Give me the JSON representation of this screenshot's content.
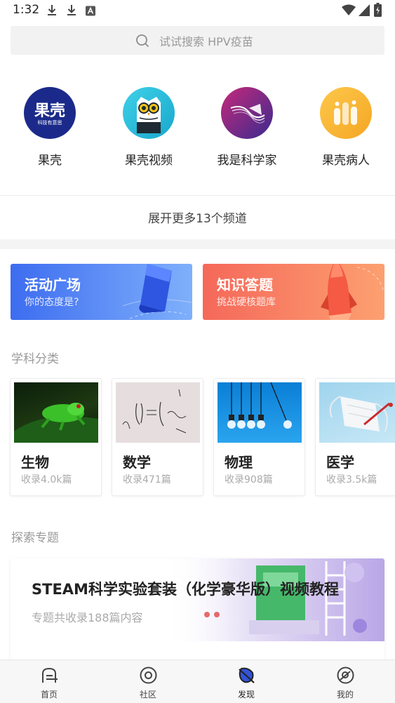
{
  "status_bar": {
    "time": "1:32",
    "icons": [
      "download-icon",
      "download-icon",
      "a-badge-icon",
      "wifi-icon",
      "signal-icon",
      "battery-icon"
    ]
  },
  "search": {
    "placeholder": "试试搜索 HPV疫苗"
  },
  "channels": [
    {
      "label": "果壳",
      "logo_text": "果壳",
      "logo_subtext": "科技有意思",
      "icon": "guokr-logo-icon"
    },
    {
      "label": "果壳视频",
      "icon": "owl-icon"
    },
    {
      "label": "我是科学家",
      "icon": "scientist-logo-icon"
    },
    {
      "label": "果壳病人",
      "icon": "patient-logo-icon"
    }
  ],
  "expand_more": "展开更多13个频道",
  "promos": [
    {
      "title": "活动广场",
      "subtitle": "你的态度是?",
      "color_from": "#3d6cf0",
      "color_to": "#7fb0fb"
    },
    {
      "title": "知识答题",
      "subtitle": "挑战硬核题库",
      "color_from": "#f5685a",
      "color_to": "#fca070"
    }
  ],
  "subjects_section_title": "学科分类",
  "subjects": [
    {
      "name": "生物",
      "count": "收录4.0k篇",
      "image": "frog-image"
    },
    {
      "name": "数学",
      "count": "收录471篇",
      "image": "math-image"
    },
    {
      "name": "物理",
      "count": "收录908篇",
      "image": "bulbs-image"
    },
    {
      "name": "医学",
      "count": "收录3.5k篇",
      "image": "mask-image"
    }
  ],
  "topics_section_title": "探索专题",
  "topic": {
    "title": "STEAM科学实验套装（化学豪华版）视频教程",
    "subtitle": "专题共收录188篇内容"
  },
  "bottom_nav": [
    {
      "label": "首页",
      "icon": "home-icon",
      "active": false
    },
    {
      "label": "社区",
      "icon": "community-icon",
      "active": false
    },
    {
      "label": "发现",
      "icon": "discover-icon",
      "active": true
    },
    {
      "label": "我的",
      "icon": "profile-icon",
      "active": false
    }
  ],
  "colors": {
    "accent_active": "#222222",
    "search_bg": "#f2f2f2",
    "section_title": "#9a9a9a"
  }
}
